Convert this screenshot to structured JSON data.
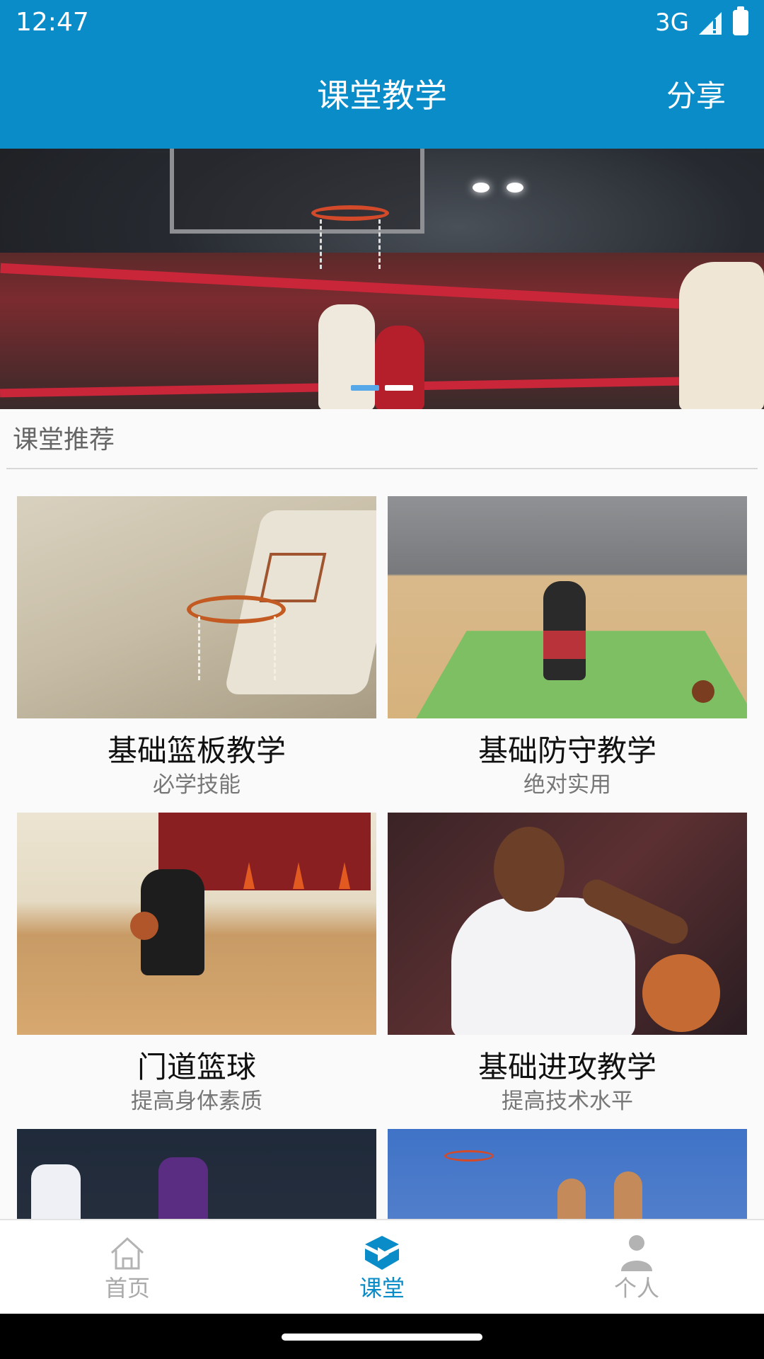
{
  "status_bar": {
    "time": "12:47",
    "network": "3G"
  },
  "header": {
    "title": "课堂教学",
    "share_label": "分享"
  },
  "banner": {
    "dots": 2,
    "active_dot": 0
  },
  "section": {
    "title": "课堂推荐"
  },
  "courses": [
    {
      "title": "基础篮板教学",
      "subtitle": "必学技能"
    },
    {
      "title": "基础防守教学",
      "subtitle": "绝对实用"
    },
    {
      "title": "门道篮球",
      "subtitle": "提高身体素质"
    },
    {
      "title": "基础进攻教学",
      "subtitle": "提高技术水平"
    }
  ],
  "bottom_nav": [
    {
      "label": "首页",
      "icon": "home-icon",
      "active": false
    },
    {
      "label": "课堂",
      "icon": "classroom-play-icon",
      "active": true
    },
    {
      "label": "个人",
      "icon": "person-icon",
      "active": false
    }
  ],
  "colors": {
    "primary": "#0a8cc8",
    "inactive": "#aaaaaa",
    "banner_dot_active": "#56a8e8"
  }
}
